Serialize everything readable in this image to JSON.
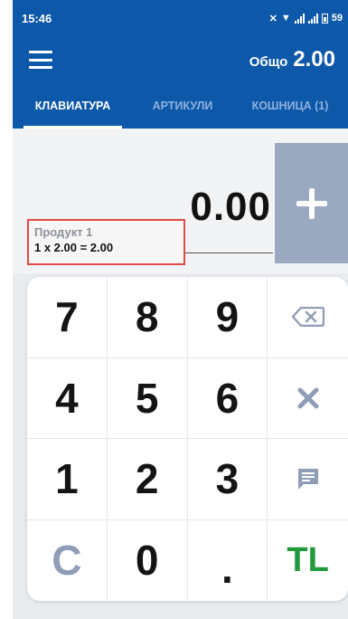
{
  "status_bar": {
    "time": "15:46",
    "battery_text": "59"
  },
  "app_bar": {
    "total_label": "Общо",
    "total_value": "2.00"
  },
  "tabs": [
    {
      "label": "КЛАВИАТУРА",
      "active": true
    },
    {
      "label": "АРТИКУЛИ",
      "active": false
    },
    {
      "label": "КОШНИЦА (1)",
      "active": false
    }
  ],
  "entry": {
    "amount": "0.00"
  },
  "product": {
    "name": "Продукт 1",
    "line": "1 x 2.00 = 2.00"
  },
  "keypad": {
    "k7": "7",
    "k8": "8",
    "k9": "9",
    "k4": "4",
    "k5": "5",
    "k6": "6",
    "k1": "1",
    "k2": "2",
    "k3": "3",
    "clear": "C",
    "k0": "0",
    "dot": ".",
    "currency": "TL"
  },
  "colors": {
    "primary": "#0d58a8",
    "plus_button": "#9aa9bf",
    "highlight_border": "#e04a4a",
    "currency_green": "#1f9a3c",
    "icon_gray": "#8f9db6"
  },
  "icons": [
    "menu-icon",
    "plus-icon",
    "backspace-icon",
    "multiply-icon",
    "note-icon"
  ]
}
